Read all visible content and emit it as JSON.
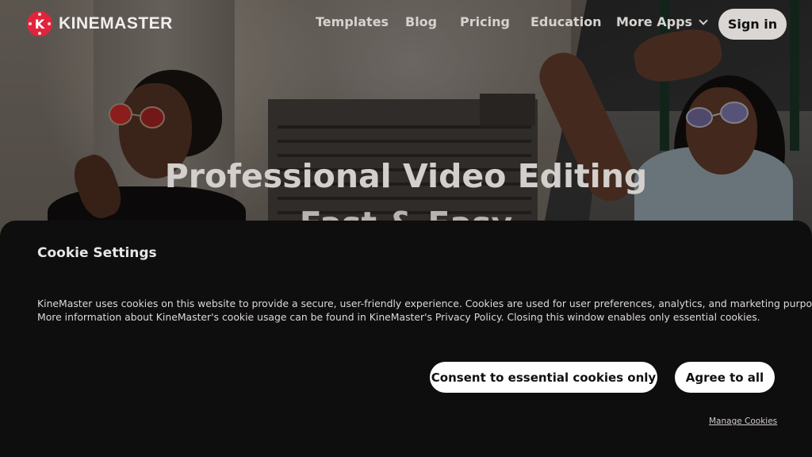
{
  "brand": {
    "name": "KINEMASTER",
    "logo_letter": "K",
    "accent_color": "#e0243d"
  },
  "nav": {
    "links": [
      "Templates",
      "Blog",
      "Pricing",
      "Education",
      "More Apps"
    ],
    "more_icon": "chevron-down-icon",
    "signin_label": "Sign in"
  },
  "hero": {
    "headline": "Professional Video Editing",
    "subline": "Fast & Easy"
  },
  "cookie": {
    "title": "Cookie Settings",
    "text_line1": "KineMaster uses cookies on this website to provide a secure, user-friendly experience. Cookies are used for user preferences, analytics, and marketing purposes.",
    "text_line2": "More information about KineMaster's cookie usage can be found in KineMaster's Privacy Policy. Closing this window enables only essential cookies.",
    "essential_label": "Consent to essential cookies only",
    "agree_label": "Agree to all",
    "manage_label": "Manage Cookies",
    "panel_color": "#0f0e0e"
  }
}
